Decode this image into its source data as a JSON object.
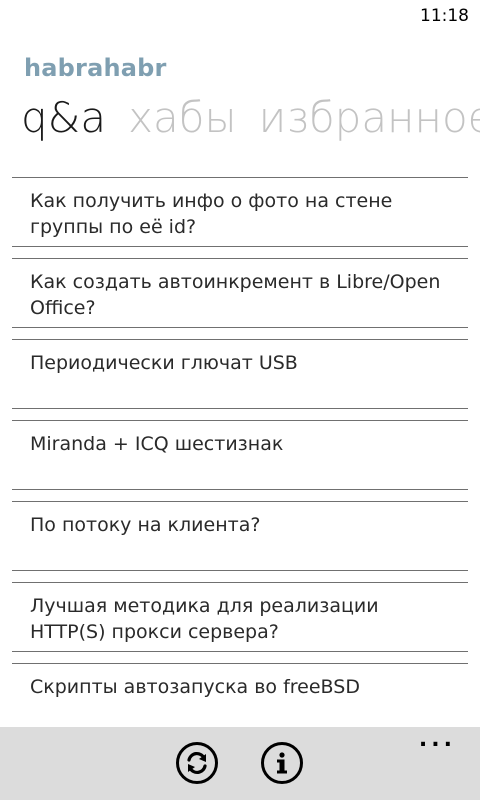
{
  "status_bar": {
    "time": "11:18"
  },
  "app": {
    "title": "habrahabr"
  },
  "pivot": {
    "items": [
      {
        "label": "q&a"
      },
      {
        "label": "хабы"
      },
      {
        "label": "избранное"
      }
    ]
  },
  "list": {
    "items": [
      {
        "text": "Как получить инфо о фото на стене группы по её id?"
      },
      {
        "text": "Как создать автоинкремент в Libre/Open Office?"
      },
      {
        "text": "Периодически глючат USB"
      },
      {
        "text": "Miranda + ICQ шестизнак"
      },
      {
        "text": "По потоку на клиента?"
      },
      {
        "text": "Лучшая методика для реализации HTTP(S) прокси сервера?"
      },
      {
        "text": "Скрипты автозапуска во freeBSD"
      }
    ]
  },
  "appbar": {
    "buttons": [
      {
        "icon": "refresh-icon"
      },
      {
        "icon": "info-icon"
      }
    ],
    "more": "..."
  }
}
